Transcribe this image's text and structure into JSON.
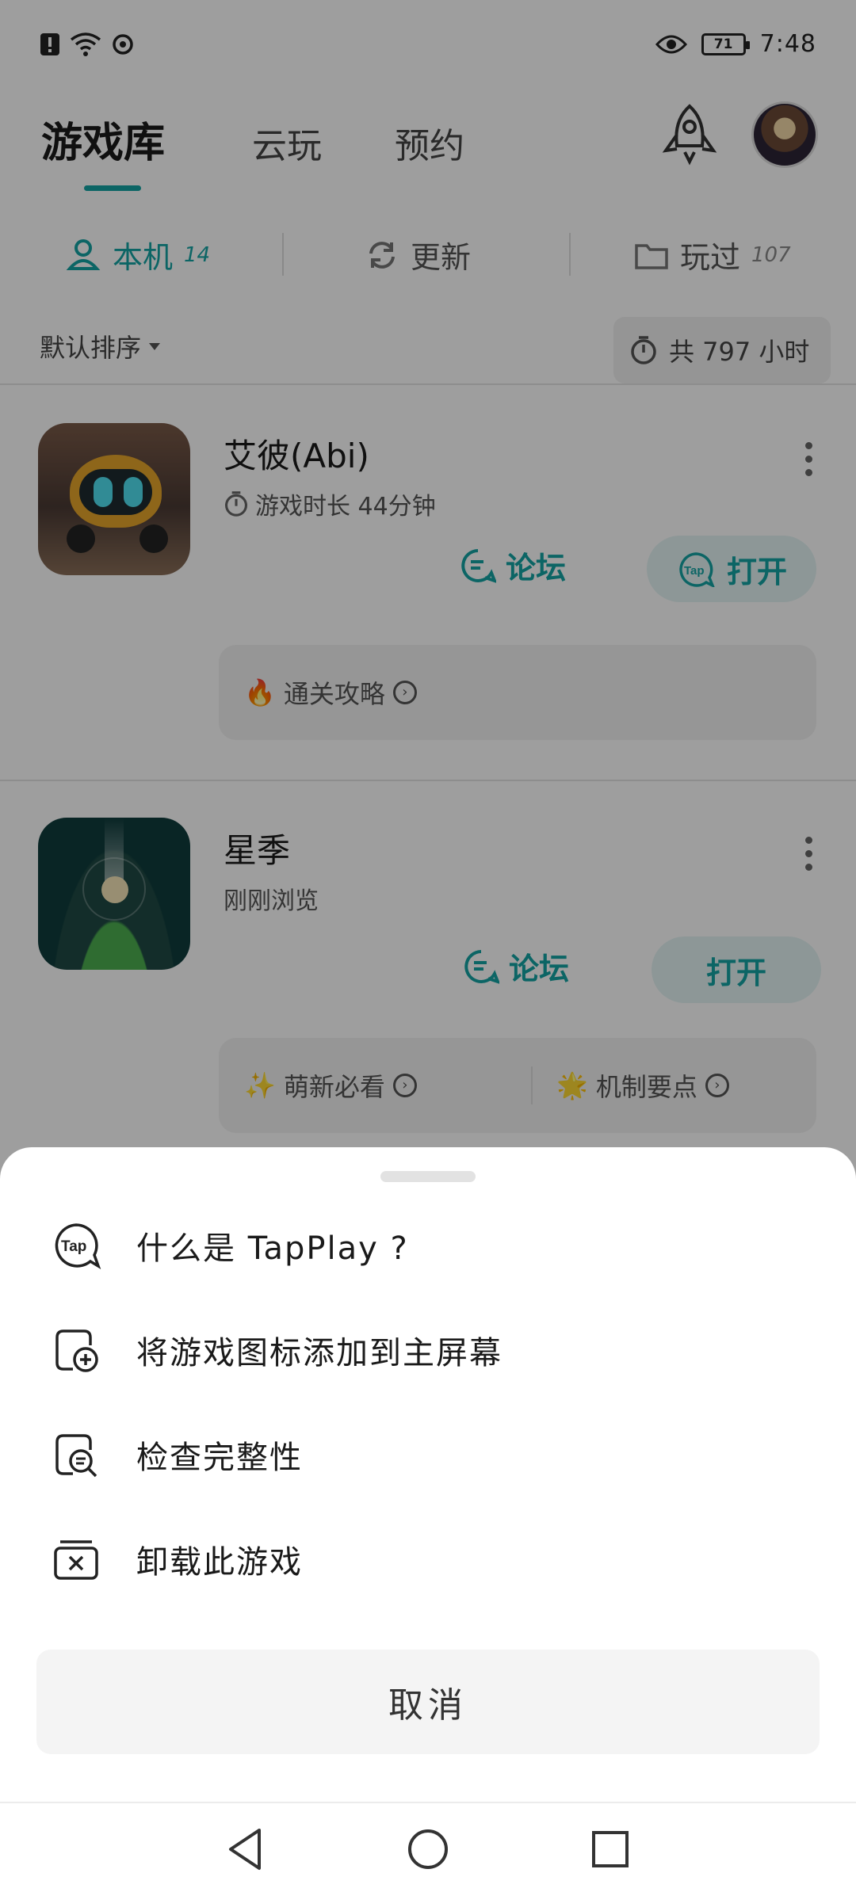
{
  "status_bar": {
    "time": "7:48",
    "battery": "71",
    "icons": [
      "alert-icon",
      "wifi-icon",
      "sync-icon",
      "eye-icon",
      "battery-icon"
    ]
  },
  "header": {
    "tabs": [
      {
        "label": "游戏库",
        "active": true
      },
      {
        "label": "云玩",
        "active": false
      },
      {
        "label": "预约",
        "active": false
      }
    ],
    "accent_color": "#14a3a3"
  },
  "subtabs": [
    {
      "label": "本机",
      "count": "14",
      "icon": "user-pin-icon",
      "active": true
    },
    {
      "label": "更新",
      "count": "",
      "icon": "refresh-icon",
      "active": false
    },
    {
      "label": "玩过",
      "count": "107",
      "icon": "folder-icon",
      "active": false
    }
  ],
  "sort": {
    "label": "默认排序",
    "total_time": "共 797 小时"
  },
  "games": [
    {
      "name": "艾彼(Abi)",
      "subtitle": "游戏时长 44分钟",
      "forum_label": "论坛",
      "open_label": "打开",
      "guides": [
        {
          "emoji": "🔥",
          "label": "通关攻略"
        }
      ]
    },
    {
      "name": "星季",
      "subtitle": "刚刚浏览",
      "forum_label": "论坛",
      "open_label": "打开",
      "guides": [
        {
          "emoji": "✨",
          "label": "萌新必看"
        },
        {
          "emoji": "🌟",
          "label": "机制要点"
        }
      ]
    }
  ],
  "sheet": {
    "items": [
      {
        "label": "什么是 TapPlay ?",
        "icon": "tap-logo-icon"
      },
      {
        "label": "将游戏图标添加到主屏幕",
        "icon": "add-to-home-icon"
      },
      {
        "label": "检查完整性",
        "icon": "check-integrity-icon"
      },
      {
        "label": "卸载此游戏",
        "icon": "uninstall-icon"
      }
    ],
    "cancel_label": "取消",
    "tap_logo_text": "Tap"
  }
}
